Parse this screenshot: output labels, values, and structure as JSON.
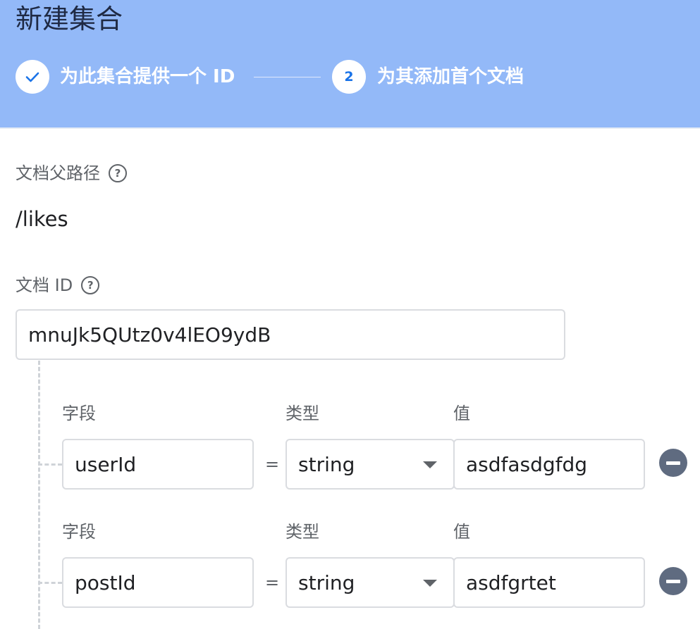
{
  "dialog": {
    "title": "新建集合"
  },
  "stepper": {
    "step1": {
      "label": "为此集合提供一个 ID",
      "status": "completed",
      "icon": "check-icon"
    },
    "step2": {
      "number": "2",
      "label": "为其添加首个文档",
      "status": "active"
    }
  },
  "parent_path": {
    "label": "文档父路径",
    "value": "/likes",
    "help_icon": "help-circle-icon"
  },
  "document_id": {
    "label": "文档 ID",
    "value": "mnuJk5QUtz0v4lEO9ydB",
    "help_icon": "help-circle-icon"
  },
  "fields": [
    {
      "field_label": "字段",
      "type_label": "类型",
      "value_label": "值",
      "name": "userId",
      "equals": "=",
      "type": "string",
      "value": "asdfasdgfdg"
    },
    {
      "field_label": "字段",
      "type_label": "类型",
      "value_label": "值",
      "name": "postId",
      "equals": "=",
      "type": "string",
      "value": "asdfgrtet"
    }
  ],
  "colors": {
    "header_bg": "#93b9f8",
    "accent": "#1a73e8",
    "remove_button": "#5f6b80"
  }
}
